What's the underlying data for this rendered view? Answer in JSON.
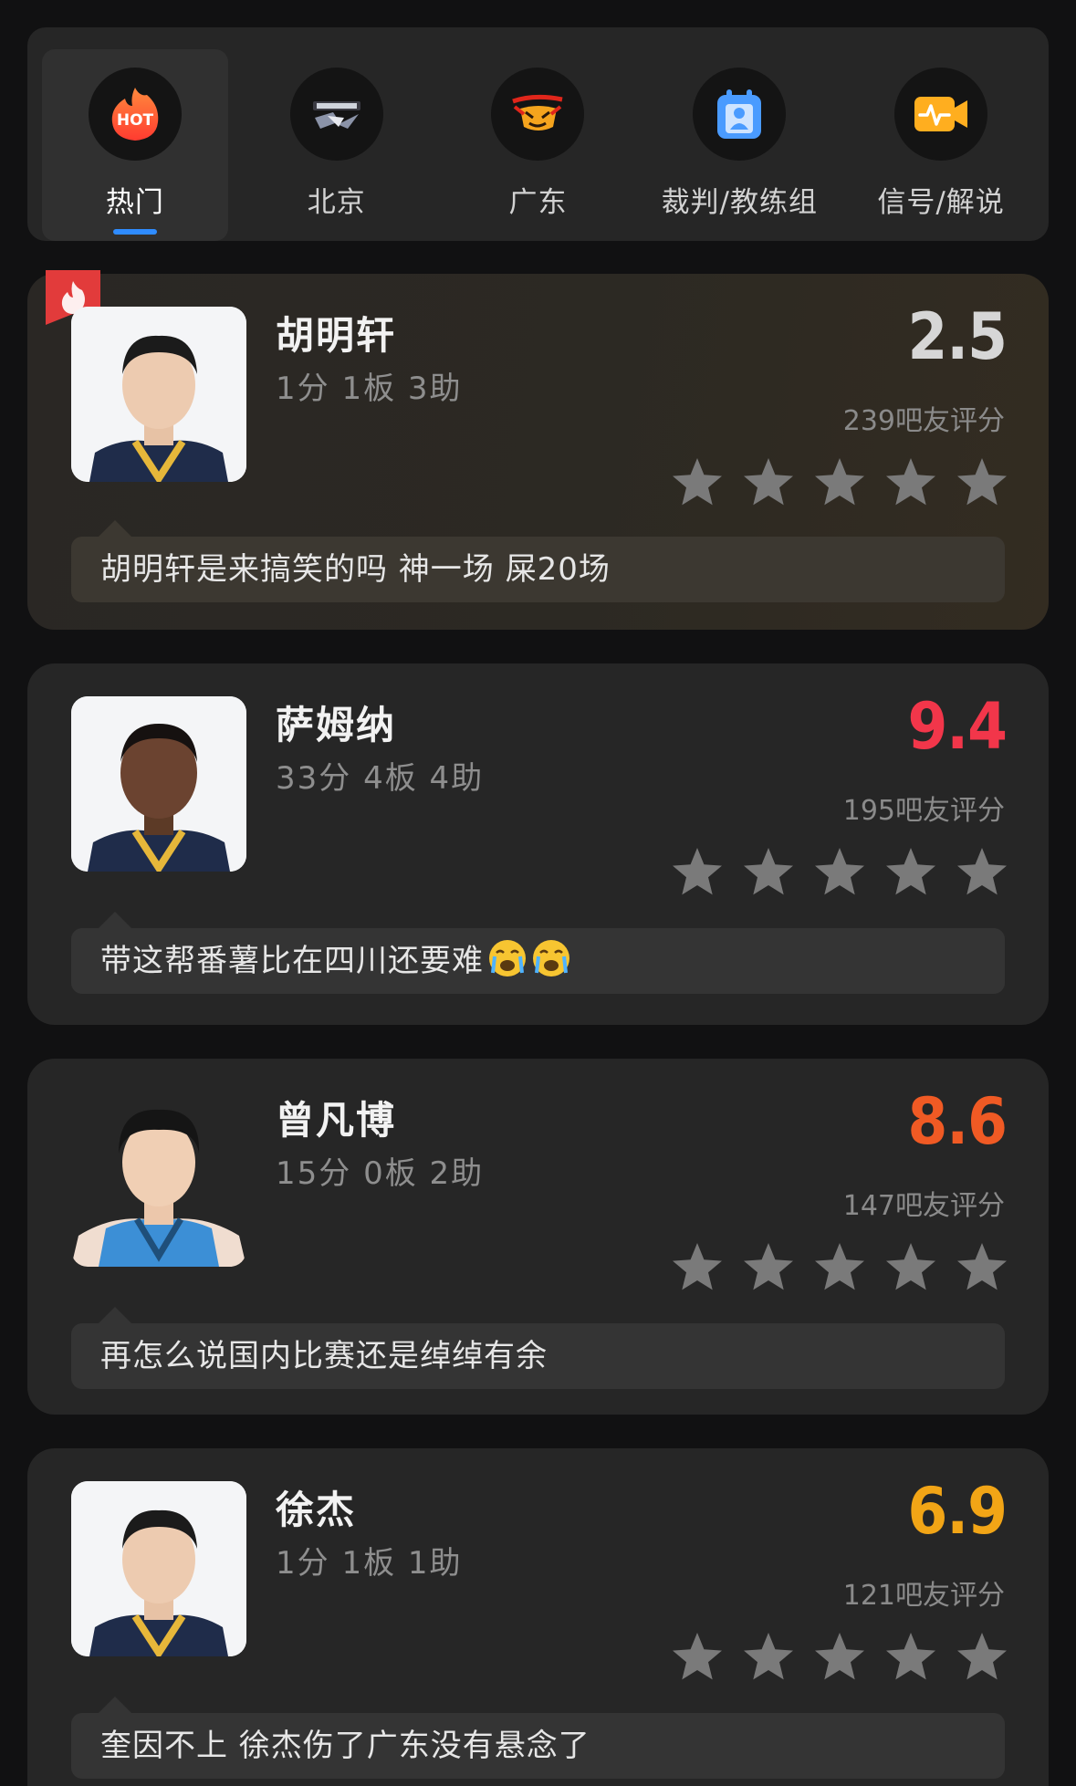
{
  "tabs": [
    {
      "label": "热门",
      "icon": "hot-icon",
      "active": true
    },
    {
      "label": "北京",
      "icon": "beijing-ducks-logo-icon",
      "active": false
    },
    {
      "label": "广东",
      "icon": "guangdong-tigers-logo-icon",
      "active": false
    },
    {
      "label": "裁判/教练组",
      "icon": "referee-badge-icon",
      "active": false
    },
    {
      "label": "信号/解说",
      "icon": "broadcast-camera-icon",
      "active": false
    }
  ],
  "hot_icon_text": "HOT",
  "players": [
    {
      "name": "胡明轩",
      "stats": "1分 1板 3助",
      "rating": "2.5",
      "rating_color": "#d6d6d6",
      "votes": "239吧友评分",
      "stars": 5,
      "comment": "胡明轩是来搞笑的吗 神一场 屎20场",
      "hot": true
    },
    {
      "name": "萨姆纳",
      "stats": "33分 4板 4助",
      "rating": "9.4",
      "rating_color": "#f2364a",
      "votes": "195吧友评分",
      "stars": 5,
      "comment": "带这帮番薯比在四川还要难",
      "comment_emoji_count": 2,
      "hot": false
    },
    {
      "name": "曾凡博",
      "stats": "15分 0板 2助",
      "rating": "8.6",
      "rating_color": "#f05a24",
      "votes": "147吧友评分",
      "stars": 5,
      "comment": "再怎么说国内比赛还是绰绰有余",
      "hot": false
    },
    {
      "name": "徐杰",
      "stats": "1分 1板 1助",
      "rating": "6.9",
      "rating_color": "#f2a516",
      "votes": "121吧友评分",
      "stars": 5,
      "comment": "奎因不上 徐杰伤了广东没有悬念了",
      "hot": false
    }
  ]
}
